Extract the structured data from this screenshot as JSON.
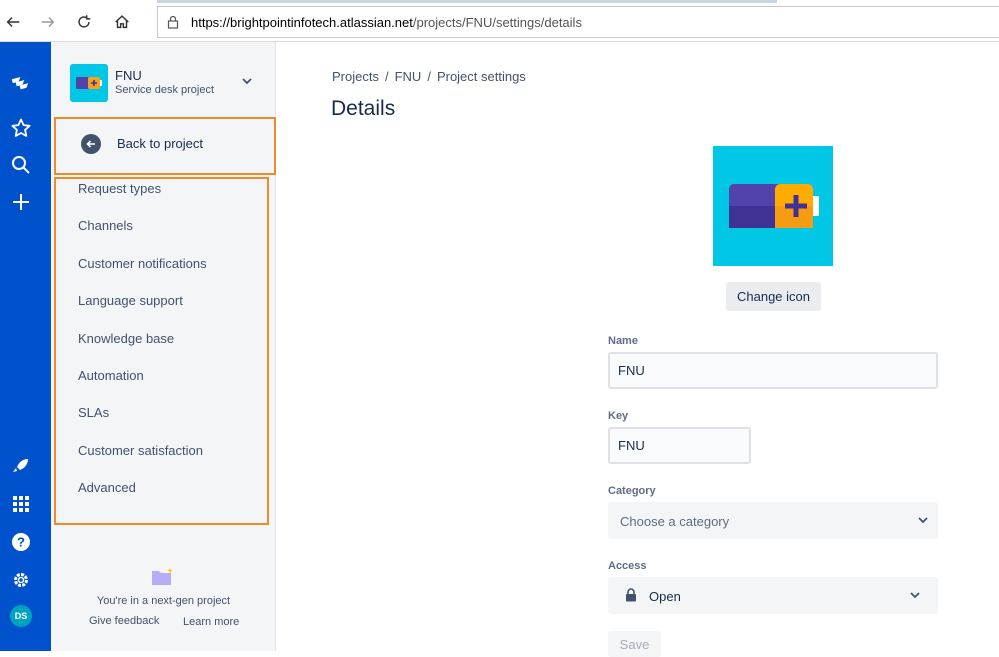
{
  "browser": {
    "url_domain": "https://brightpointinfotech.atlassian.net",
    "url_path": "/projects/FNU/settings/details"
  },
  "global_nav": {
    "icons": [
      "jira-logo-icon",
      "star-icon",
      "search-icon",
      "plus-icon",
      "rocket-icon",
      "apps-grid-icon",
      "help-icon",
      "gear-icon"
    ],
    "avatar_initials": "DS",
    "bg_color": "#0052cc"
  },
  "sidebar": {
    "project_name": "FNU",
    "project_type": "Service desk project",
    "back_label": "Back to project",
    "items": [
      {
        "label": "Request types"
      },
      {
        "label": "Channels"
      },
      {
        "label": "Customer notifications"
      },
      {
        "label": "Language support"
      },
      {
        "label": "Knowledge base"
      },
      {
        "label": "Automation"
      },
      {
        "label": "SLAs"
      },
      {
        "label": "Customer satisfaction"
      },
      {
        "label": "Advanced"
      }
    ],
    "nextgen_text": "You're in a next-gen project",
    "feedback_link": "Give feedback",
    "learn_link": "Learn more",
    "highlight_color": "#f08a2a"
  },
  "main": {
    "breadcrumb": [
      "Projects",
      "FNU",
      "Project settings"
    ],
    "title": "Details",
    "change_icon_label": "Change icon",
    "fields": {
      "name_label": "Name",
      "name_value": "FNU",
      "key_label": "Key",
      "key_value": "FNU",
      "category_label": "Category",
      "category_placeholder": "Choose a category",
      "access_label": "Access",
      "access_value": "Open"
    },
    "save_label": "Save"
  }
}
